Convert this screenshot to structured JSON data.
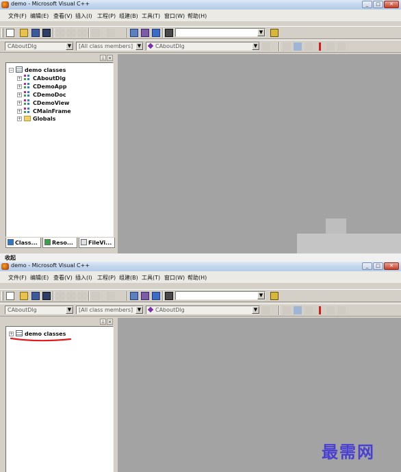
{
  "window": {
    "title": "demo - Microsoft Visual C++",
    "controls": [
      "_",
      "□",
      "✕"
    ]
  },
  "menu": [
    "文件(F)",
    "编辑(E)",
    "查看(V)",
    "插入(I)",
    "工程(P)",
    "组建(B)",
    "工具(T)",
    "窗口(W)",
    "帮助(H)"
  ],
  "wizardbar": {
    "class_combo": "CAboutDlg",
    "filter_combo": "[All class members]",
    "member_combo": "CAboutDlg"
  },
  "workspace": {
    "root": "demo classes",
    "items": [
      "CAboutDlg",
      "CDemoApp",
      "CDemoDoc",
      "CDemoView",
      "CMainFrame",
      "Globals"
    ],
    "tabs": [
      "Class...",
      "Reso...",
      "FileVi..."
    ]
  },
  "caption_between": "收起",
  "watermark": "最需网",
  "colors": {
    "client_area": "#a3a3a3",
    "annotation": "#e3191c",
    "watermark": "#4a3fd3"
  }
}
